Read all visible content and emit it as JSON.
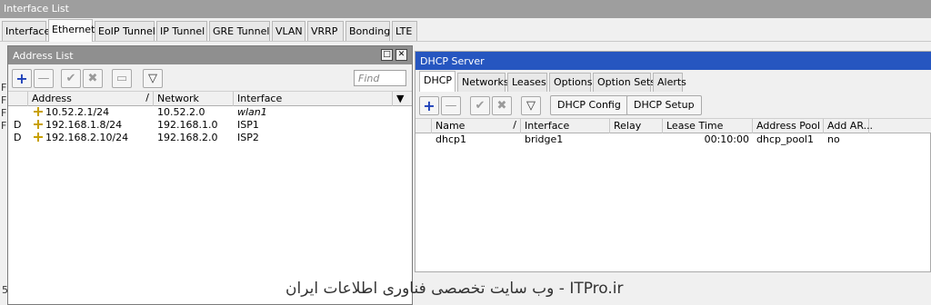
{
  "interface_list": {
    "title": "Interface List",
    "tabs": [
      "Interface",
      "Ethernet",
      "EoIP Tunnel",
      "IP Tunnel",
      "GRE Tunnel",
      "VLAN",
      "VRRP",
      "Bonding",
      "LTE"
    ],
    "left_chars": [
      "F",
      "F",
      "F",
      "F"
    ],
    "bottom_count": "5"
  },
  "address_list": {
    "title": "Address List",
    "find_placeholder": "Find",
    "columns": [
      "Address",
      "Network",
      "Interface"
    ],
    "rows": [
      {
        "flag": "",
        "address": "10.52.2.1/24",
        "network": "10.52.2.0",
        "interface": "wlan1"
      },
      {
        "flag": "D",
        "address": "192.168.1.8/24",
        "network": "192.168.1.0",
        "interface": "ISP1"
      },
      {
        "flag": "D",
        "address": "192.168.2.10/24",
        "network": "192.168.2.0",
        "interface": "ISP2"
      }
    ]
  },
  "dhcp_server": {
    "title": "DHCP Server",
    "tabs": [
      "DHCP",
      "Networks",
      "Leases",
      "Options",
      "Option Sets",
      "Alerts"
    ],
    "config_button": "DHCP Config",
    "setup_button": "DHCP Setup",
    "columns": [
      "Name",
      "Interface",
      "Relay",
      "Lease Time",
      "Address Pool",
      "Add AR..."
    ],
    "rows": [
      {
        "name": "dhcp1",
        "interface": "bridge1",
        "relay": "",
        "lease_time": "00:10:00",
        "address_pool": "dhcp_pool1",
        "add_arp": "no"
      }
    ]
  },
  "watermark": "وب سایت تخصصی فناوری اطلاعات ایران - ITPro.ir"
}
